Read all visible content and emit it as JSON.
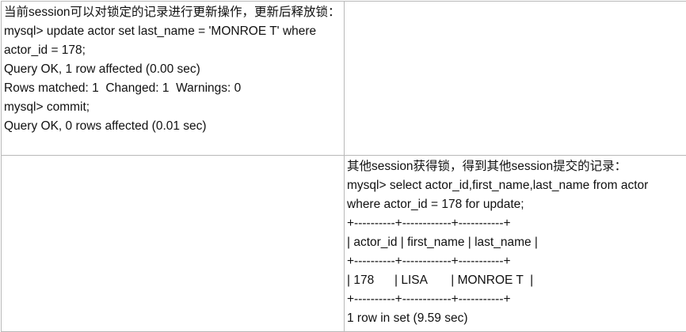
{
  "table": {
    "row1": {
      "left": {
        "lines": [
          "当前session可以对锁定的记录进行更新操作，更新后释放锁：",
          "mysql> update actor set last_name = 'MONROE T' where actor_id = 178;",
          "Query OK, 1 row affected (0.00 sec)",
          "Rows matched: 1  Changed: 1  Warnings: 0",
          "mysql> commit;",
          "Query OK, 0 rows affected (0.01 sec)"
        ]
      },
      "right": {
        "lines": []
      }
    },
    "row2": {
      "left": {
        "lines": []
      },
      "right": {
        "lines": [
          "其他session获得锁，得到其他session提交的记录：",
          "mysql> select actor_id,first_name,last_name from actor where actor_id = 178 for update;",
          "+----------+------------+-----------+",
          "| actor_id | first_name | last_name |",
          "+----------+------------+-----------+",
          "| 178      | LISA       | MONROE T  |",
          "+----------+------------+-----------+",
          "1 row in set (9.59 sec)"
        ]
      }
    }
  }
}
